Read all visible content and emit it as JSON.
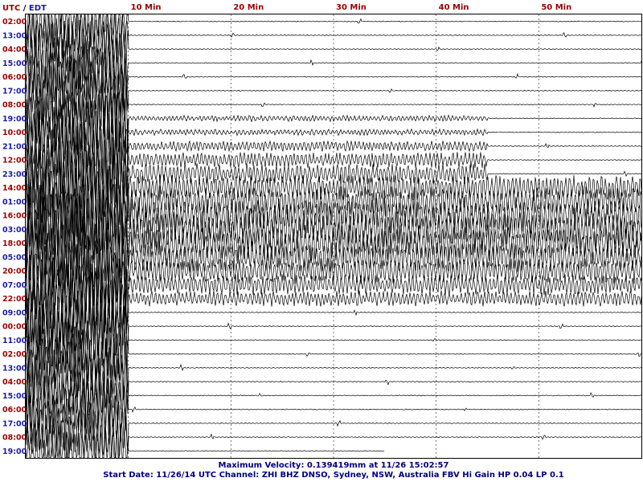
{
  "header": {
    "utc": "UTC",
    "sep": "/",
    "local": "EDT"
  },
  "chart_data": {
    "type": "line",
    "x_axis": {
      "unit_label": "Min",
      "range": [
        0,
        60
      ],
      "ticks": [
        {
          "value": 10,
          "label": "10 Min"
        },
        {
          "value": 20,
          "label": "20 Min"
        },
        {
          "value": 30,
          "label": "30 Min"
        },
        {
          "value": 40,
          "label": "40 Min"
        },
        {
          "value": 50,
          "label": "50 Min"
        }
      ]
    },
    "row_labels": [
      {
        "utc": "02:00",
        "local": "13:00"
      },
      {
        "utc": "04:00",
        "local": "15:00"
      },
      {
        "utc": "06:00",
        "local": "17:00"
      },
      {
        "utc": "08:00",
        "local": "19:00"
      },
      {
        "utc": "10:00",
        "local": "21:00"
      },
      {
        "utc": "12:00",
        "local": "23:00"
      },
      {
        "utc": "14:00",
        "local": "01:00"
      },
      {
        "utc": "16:00",
        "local": "03:00"
      },
      {
        "utc": "18:00",
        "local": "05:00"
      },
      {
        "utc": "20:00",
        "local": "07:00"
      },
      {
        "utc": "22:00",
        "local": "09:00"
      },
      {
        "utc": "00:00",
        "local": "11:00"
      },
      {
        "utc": "02:00",
        "local": "13:00"
      },
      {
        "utc": "04:00",
        "local": "15:00"
      },
      {
        "utc": "06:00",
        "local": "17:00"
      },
      {
        "utc": "08:00",
        "local": "19:00"
      }
    ],
    "hours_per_trace": 1,
    "trace_count": 32,
    "last_trace_end_minute": 35,
    "activity": [
      {
        "traces": [
          0,
          31
        ],
        "minutes": [
          0,
          10
        ],
        "level": "very-high",
        "note": "large earthquake arrival"
      },
      {
        "traces": [
          7,
          20
        ],
        "minutes": [
          10,
          45
        ],
        "level": "high"
      },
      {
        "traces": [
          12,
          20
        ],
        "minutes": [
          42,
          60
        ],
        "level": "high"
      }
    ],
    "colors": {
      "utc": "#990000",
      "local": "#1a1aa6",
      "trace": "#000000",
      "grid": "#555555",
      "footer": "#000080"
    }
  },
  "footer": {
    "line1": "Maximum Velocity: 0.139419mm at 11/26 15:02:57",
    "line2": "Start Date: 11/26/14 UTC Channel: ZHI  BHZ  DNSO, Sydney, NSW, Australia  FBV Hi Gain HP 0.04 LP 0.1"
  }
}
